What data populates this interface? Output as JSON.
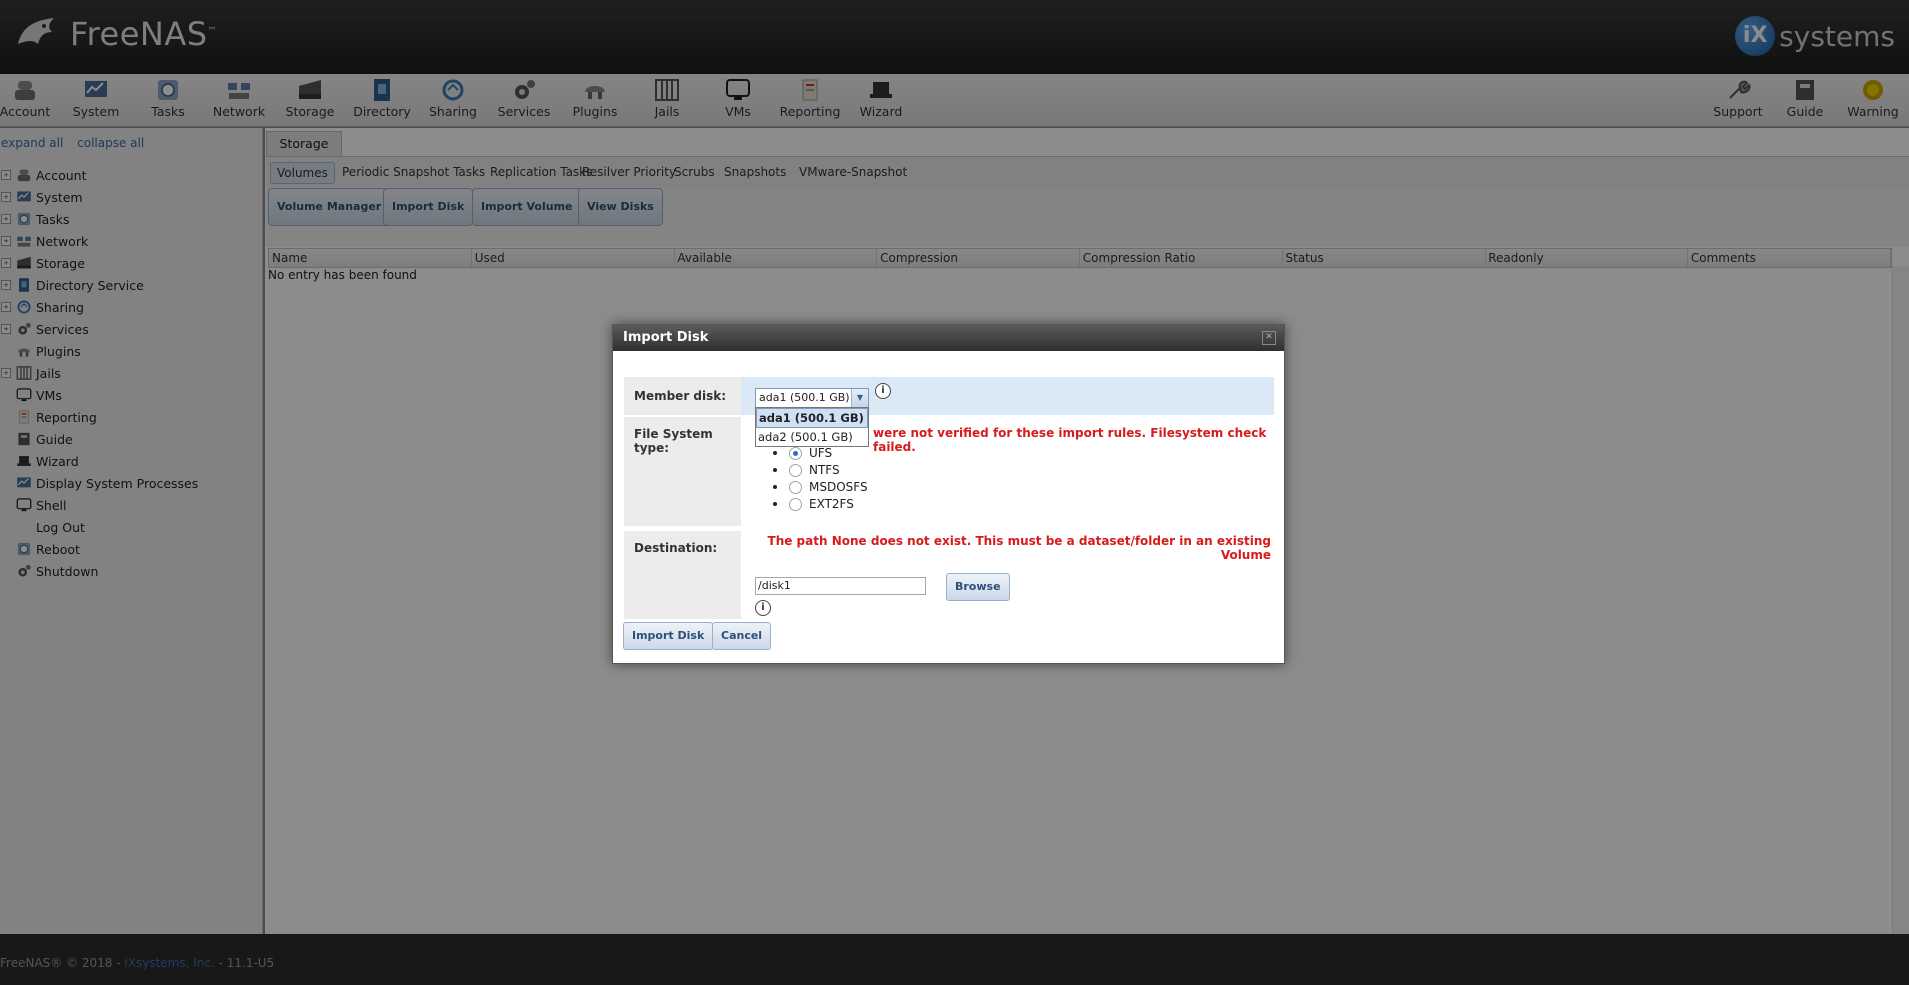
{
  "header": {
    "brand": "FreeNAS",
    "trademark": "™",
    "partner_badge": "iX",
    "partner_text": "systems"
  },
  "toolbar": {
    "left": [
      {
        "label": "Account",
        "icon": "account-icon"
      },
      {
        "label": "System",
        "icon": "system-icon"
      },
      {
        "label": "Tasks",
        "icon": "tasks-icon"
      },
      {
        "label": "Network",
        "icon": "network-icon"
      },
      {
        "label": "Storage",
        "icon": "storage-icon"
      },
      {
        "label": "Directory",
        "icon": "directory-icon"
      },
      {
        "label": "Sharing",
        "icon": "sharing-icon"
      },
      {
        "label": "Services",
        "icon": "services-icon"
      },
      {
        "label": "Plugins",
        "icon": "plugins-icon"
      },
      {
        "label": "Jails",
        "icon": "jails-icon"
      },
      {
        "label": "VMs",
        "icon": "vms-icon"
      },
      {
        "label": "Reporting",
        "icon": "reporting-icon"
      },
      {
        "label": "Wizard",
        "icon": "wizard-icon"
      }
    ],
    "right": [
      {
        "label": "Support",
        "icon": "support-icon"
      },
      {
        "label": "Guide",
        "icon": "guide-icon"
      },
      {
        "label": "Warning",
        "icon": "warning-icon"
      }
    ]
  },
  "tree": {
    "expand_all": "expand all",
    "collapse_all": "collapse all",
    "items": [
      {
        "label": "Account",
        "expandable": true
      },
      {
        "label": "System",
        "expandable": true
      },
      {
        "label": "Tasks",
        "expandable": true
      },
      {
        "label": "Network",
        "expandable": true
      },
      {
        "label": "Storage",
        "expandable": true
      },
      {
        "label": "Directory Service",
        "expandable": true
      },
      {
        "label": "Sharing",
        "expandable": true
      },
      {
        "label": "Services",
        "expandable": true
      },
      {
        "label": "Plugins",
        "expandable": false
      },
      {
        "label": "Jails",
        "expandable": true
      },
      {
        "label": "VMs",
        "expandable": false
      },
      {
        "label": "Reporting",
        "expandable": false
      },
      {
        "label": "Guide",
        "expandable": false
      },
      {
        "label": "Wizard",
        "expandable": false
      },
      {
        "label": "Display System Processes",
        "expandable": false
      },
      {
        "label": "Shell",
        "expandable": false
      },
      {
        "label": "Log Out",
        "expandable": false
      },
      {
        "label": "Reboot",
        "expandable": false
      },
      {
        "label": "Shutdown",
        "expandable": false
      }
    ]
  },
  "main": {
    "tab": "Storage",
    "subtabs": [
      "Volumes",
      "Periodic Snapshot Tasks",
      "Replication Tasks",
      "Resilver Priority",
      "Scrubs",
      "Snapshots",
      "VMware-Snapshot"
    ],
    "buttons": [
      "Volume Manager",
      "Import Disk",
      "Import Volume",
      "View Disks"
    ],
    "columns": [
      "Name",
      "Used",
      "Available",
      "Compression",
      "Compression Ratio",
      "Status",
      "Readonly",
      "Comments"
    ],
    "empty_text": "No entry has been found"
  },
  "dialog": {
    "title": "Import Disk",
    "member_label": "Member disk:",
    "member_value": "ada1 (500.1 GB)",
    "options": [
      "ada1 (500.1 GB)",
      "ada2 (500.1 GB)"
    ],
    "fs_label": "File System type:",
    "fs_error": "were not verified for these import rules. Filesystem check failed.",
    "fs_options": [
      "UFS",
      "NTFS",
      "MSDOSFS",
      "EXT2FS"
    ],
    "fs_selected": "UFS",
    "dest_label": "Destination:",
    "dest_error": "The path None does not exist. This must be a dataset/folder in an existing Volume",
    "dest_value": "/disk1",
    "browse": "Browse",
    "import_btn": "Import Disk",
    "cancel_btn": "Cancel",
    "info_glyph": "i"
  },
  "footer": {
    "prefix": "FreeNAS® © 2018 - ",
    "company": "iXsystems, Inc.",
    "suffix": " - 11.1-U5"
  }
}
